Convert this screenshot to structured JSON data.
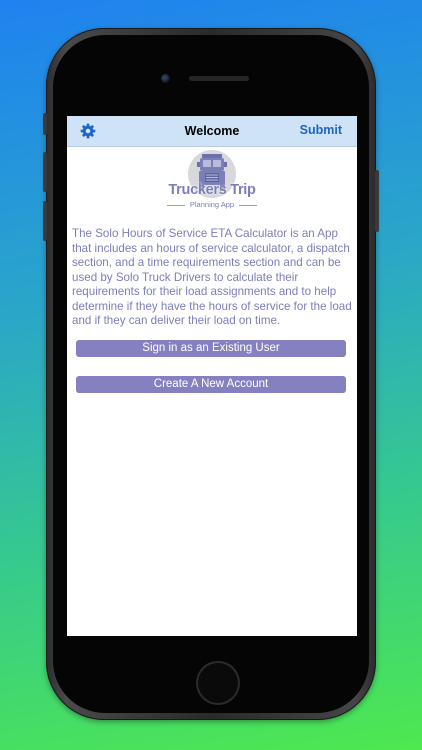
{
  "navbar": {
    "title": "Welcome",
    "submit_label": "Submit",
    "settings_icon": "gear-icon",
    "accent_color": "#1d66c4",
    "background_color": "#cfe3f6"
  },
  "logo": {
    "title": "Truckers Trip",
    "subtitle": "Planning App",
    "icon": "truck-icon"
  },
  "description": "The Solo Hours of Service ETA Calculator is an App that includes an hours of service calculator, a dispatch section, and a time requirements section and can be used by Solo Truck Drivers to calculate their requirements for their load assignments and to help determine if they have the hours of service for the load and if they can deliver their load on time.",
  "buttons": {
    "sign_in": "Sign in as an Existing User",
    "create_account": "Create A New Account",
    "color": "#8580c0"
  }
}
